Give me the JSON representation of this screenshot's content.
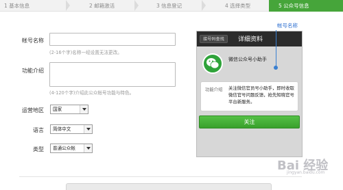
{
  "steps": [
    {
      "label": "1 基本信息",
      "active": false
    },
    {
      "label": "2 邮箱激活",
      "active": false
    },
    {
      "label": "3 信息登记",
      "active": false
    },
    {
      "label": "4 选择类型",
      "active": false
    },
    {
      "label": "5 公众号信息",
      "active": true
    }
  ],
  "form": {
    "account_name_label": "帐号名称",
    "account_name_value": "",
    "account_name_hint": "(2-16个字)名称一经设置无法更改。",
    "function_label": "功能介绍",
    "function_value": "",
    "function_hint": "(4-120个字)介绍此公众帐号功能与特色。",
    "region_label": "运营地区",
    "region_value": "国家",
    "language_label": "语言",
    "language_value": "简体中文",
    "type_label": "类型",
    "type_value": "普通公众帐"
  },
  "preview": {
    "back_label": "接号码查找",
    "title": "详细资料",
    "account_name": "微信公众号小助手",
    "info_label": "功能介绍",
    "info_text": "关注微信官员号小助手，即时收取微信官号问题反馈，抢先知晓官号平台新服务。",
    "follow_label": "关注"
  },
  "annotation": {
    "label": "帐号名称"
  },
  "watermark": {
    "text": "Bai 经验",
    "sub": "jingyan.baidu.com"
  },
  "colors": {
    "active_step": "#46a53a",
    "follow_button": "#39a02c",
    "annotation": "#3a7fd0"
  }
}
